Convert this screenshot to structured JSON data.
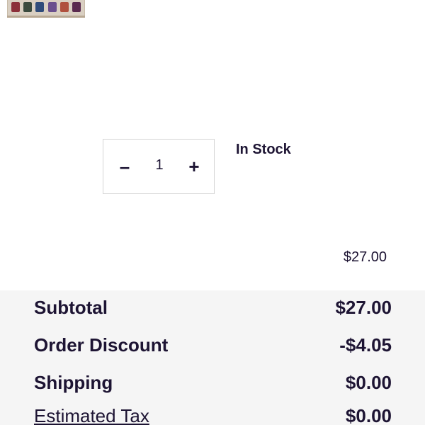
{
  "product": {
    "thumbnail_icon": "eyeshadow-palette-thumbnail",
    "pan_colors": [
      "#8c2f3a",
      "#3a4a3e",
      "#2f4b7a",
      "#6a4f8e",
      "#b0503e",
      "#5a2a4f"
    ]
  },
  "quantity": {
    "decrement_label": "–",
    "value": "1",
    "increment_label": "+"
  },
  "stock_status": "In Stock",
  "line_price": "$27.00",
  "summary": {
    "rows": [
      {
        "label": "Subtotal",
        "value": "$27.00"
      },
      {
        "label": "Order Discount",
        "value": "-$4.05"
      },
      {
        "label": "Shipping",
        "value": "$0.00"
      },
      {
        "label": "Estimated Tax",
        "value": "$0.00"
      }
    ]
  }
}
